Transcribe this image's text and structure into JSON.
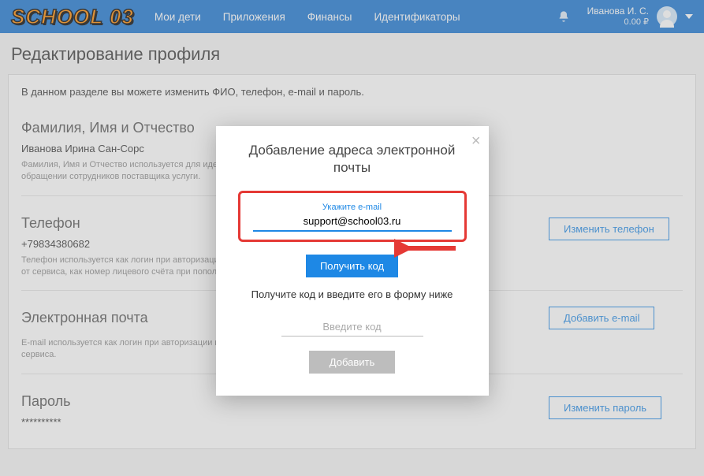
{
  "header": {
    "logo": "SCHOOL 03",
    "nav": [
      "Мои дети",
      "Приложения",
      "Финансы",
      "Идентификаторы"
    ],
    "user_name": "Иванова И. С.",
    "balance": "0.00 ₽"
  },
  "page": {
    "title": "Редактирование профиля",
    "intro": "В данном разделе вы можете изменить ФИО, телефон, e-mail и пароль.",
    "fio": {
      "heading": "Фамилия, Имя и Отчество",
      "value": "Иванова Ирина Сан-Сорс",
      "hint": "Фамилия, Имя и Отчество используется для идентификации при работе с сервисом и при обращении сотрудников поставщика услуги."
    },
    "phone": {
      "heading": "Телефон",
      "value": "+79834380682",
      "button": "Изменить телефон",
      "hint": "Телефон используется как логин при авторизации, для получения различных уведомлений от сервиса, как номер лицевого счёта при пополнении счета за услуги и питание детей."
    },
    "email": {
      "heading": "Электронная почта",
      "button": "Добавить e-mail",
      "hint": "E-mail используется как логин при авторизации и для получения различных уведомлений от сервиса."
    },
    "password": {
      "heading": "Пароль",
      "value": "**********",
      "button": "Изменить пароль"
    }
  },
  "modal": {
    "title": "Добавление адреса электронной почты",
    "field_label": "Укажите e-mail",
    "field_value": "support@school03.ru",
    "get_code_btn": "Получить код",
    "hint": "Получите код и введите его в форму ниже",
    "code_placeholder": "Введите код",
    "add_btn": "Добавить"
  }
}
